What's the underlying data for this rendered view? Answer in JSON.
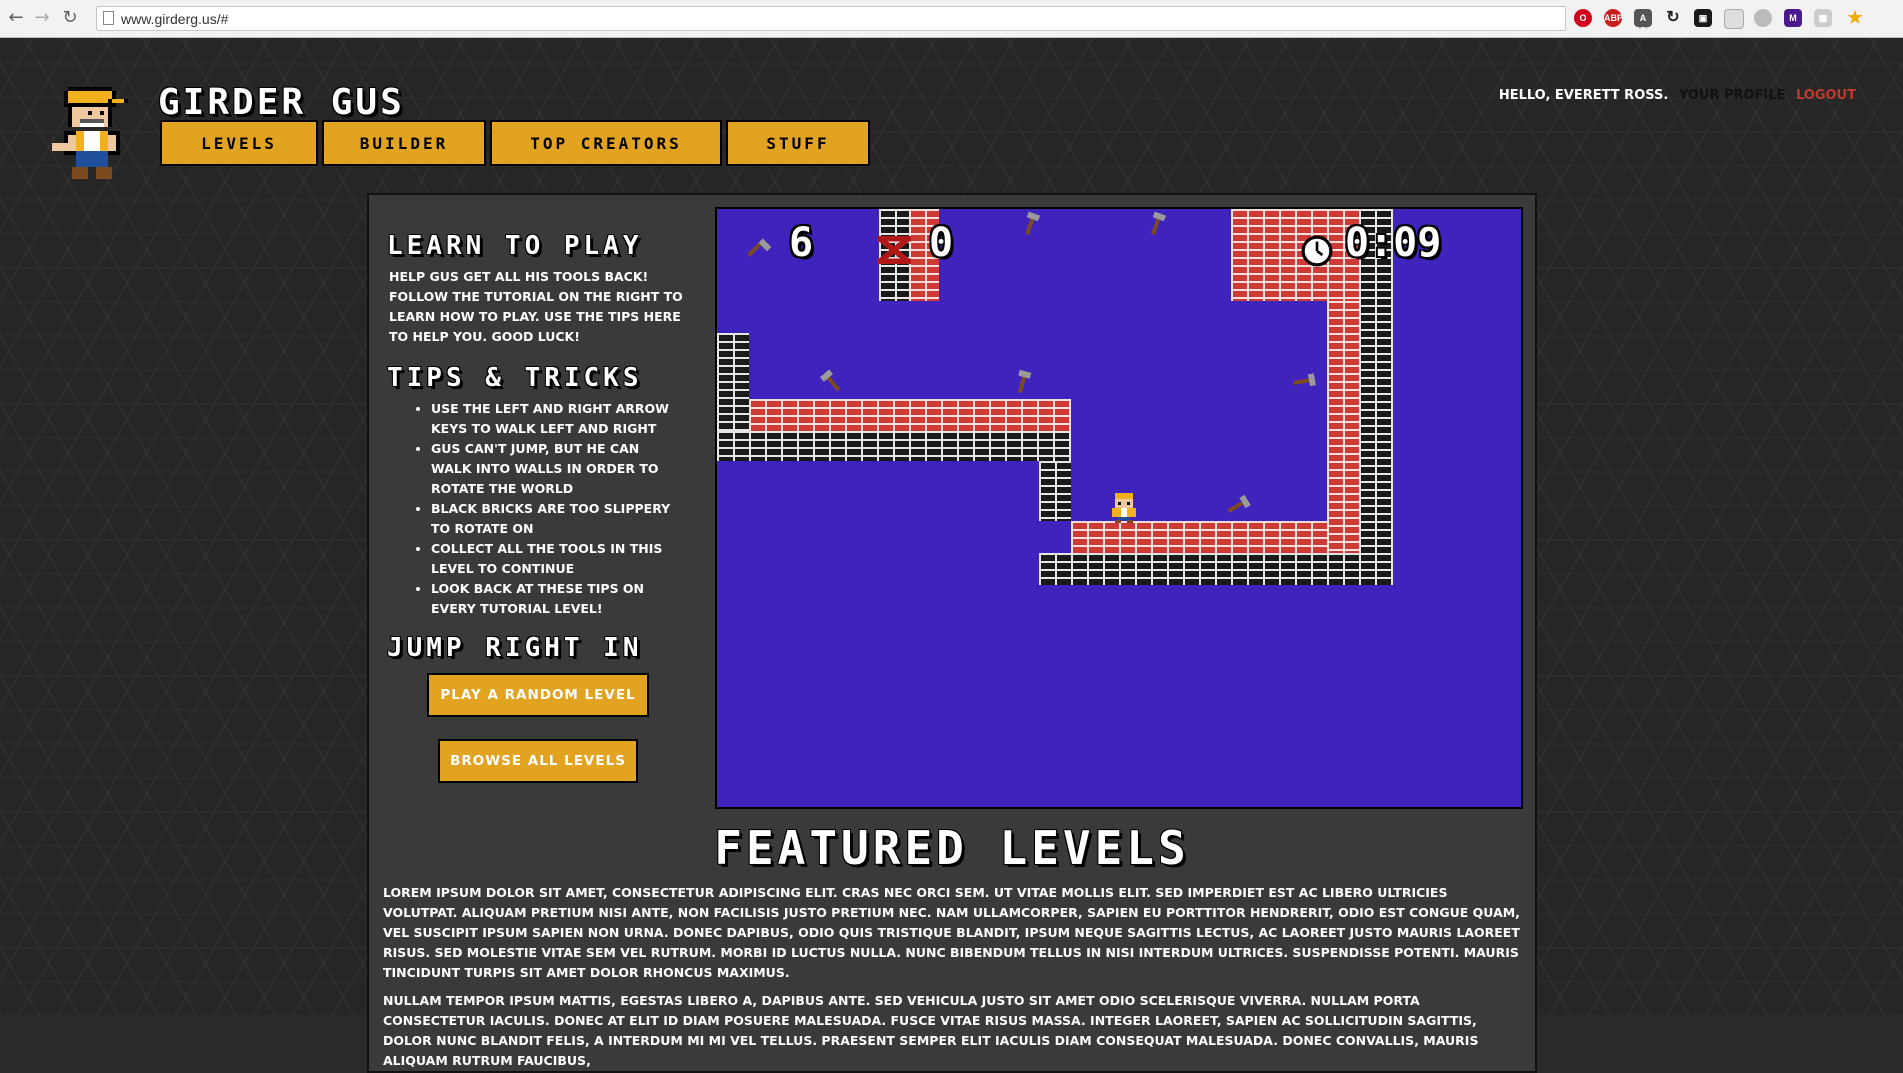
{
  "browser": {
    "url": "www.girderg.us/#",
    "extensions": [
      "opera-icon",
      "adblock-icon",
      "angular-icon",
      "sync-icon",
      "screen-icon",
      "reader-icon",
      "edge-icon",
      "m-icon",
      "grid-icon",
      "star-badge-icon"
    ],
    "ext_labels": {
      "adblock": "ABP",
      "m": "M"
    }
  },
  "header": {
    "title": "GIRDER GUS",
    "nav": [
      {
        "label": "LEVELS"
      },
      {
        "label": "BUILDER"
      },
      {
        "label": "TOP CREATORS"
      },
      {
        "label": "STUFF"
      }
    ],
    "greeting": "HELLO, EVERETT ROSS.",
    "profile_link": "YOUR PROFILE",
    "logout_link": "LOGOUT"
  },
  "learn": {
    "title": "LEARN TO PLAY",
    "text": "HELP GUS GET ALL HIS TOOLS BACK! FOLLOW THE TUTORIAL ON THE RIGHT TO LEARN HOW TO PLAY. USE THE TIPS HERE TO HELP YOU. GOOD LUCK!"
  },
  "tips": {
    "title": "TIPS & TRICKS",
    "items": [
      "USE THE LEFT AND RIGHT ARROW KEYS TO WALK LEFT AND RIGHT",
      "GUS CAN'T JUMP, BUT HE CAN WALK INTO WALLS IN ORDER TO ROTATE THE WORLD",
      "BLACK BRICKS ARE TOO SLIPPERY TO ROTATE ON",
      "COLLECT ALL THE TOOLS IN THIS LEVEL TO CONTINUE",
      "LOOK BACK AT THESE TIPS ON EVERY TUTORIAL LEVEL!"
    ]
  },
  "jump": {
    "title": "JUMP RIGHT IN",
    "random_button": "PLAY A RANDOM LEVEL",
    "browse_button": "BROWSE ALL LEVELS"
  },
  "game": {
    "tools_remaining": "6",
    "deaths": "0",
    "timer": "0:09",
    "colors": {
      "background": "#4023bd",
      "red_brick": "#cf3a34",
      "black_brick": "#1b1b1b"
    }
  },
  "featured": {
    "title": "FEATURED LEVELS",
    "paragraphs": [
      "LOREM IPSUM DOLOR SIT AMET, CONSECTETUR ADIPISCING ELIT. CRAS NEC ORCI SEM. UT VITAE MOLLIS ELIT. SED IMPERDIET EST AC LIBERO ULTRICIES VOLUTPAT. ALIQUAM PRETIUM NISI ANTE, NON FACILISIS JUSTO PRETIUM NEC. NAM ULLAMCORPER, SAPIEN EU PORTTITOR HENDRERIT, ODIO EST CONGUE QUAM, VEL SUSCIPIT IPSUM SAPIEN NON URNA. DONEC DAPIBUS, ODIO QUIS TRISTIQUE BLANDIT, IPSUM NEQUE SAGITTIS LECTUS, AC LAOREET JUSTO MAURIS LAOREET RISUS. SED MOLESTIE VITAE SEM VEL RUTRUM. MORBI ID LUCTUS NULLA. NUNC BIBENDUM TELLUS IN NISI INTERDUM ULTRICES. SUSPENDISSE POTENTI. MAURIS TINCIDUNT TURPIS SIT AMET DOLOR RHONCUS MAXIMUS.",
      "NULLAM TEMPOR IPSUM MATTIS, EGESTAS LIBERO A, DAPIBUS ANTE. SED VEHICULA JUSTO SIT AMET ODIO SCELERISQUE VIVERRA. NULLAM PORTA CONSECTETUR IACULIS. DONEC AT ELIT ID DIAM POSUERE MALESUADA. FUSCE VITAE RISUS MASSA. INTEGER LAOREET, SAPIEN AC SOLLICITUDIN SAGITTIS, DOLOR NUNC BLANDIT FELIS, A INTERDUM MI MI VEL TELLUS. PRAESENT SEMPER ELIT IACULIS DIAM CONSEQUAT MALESUADA. DONEC CONVALLIS, MAURIS ALIQUAM RUTRUM FAUCIBUS,"
    ]
  },
  "accent_color": "#e2a321"
}
